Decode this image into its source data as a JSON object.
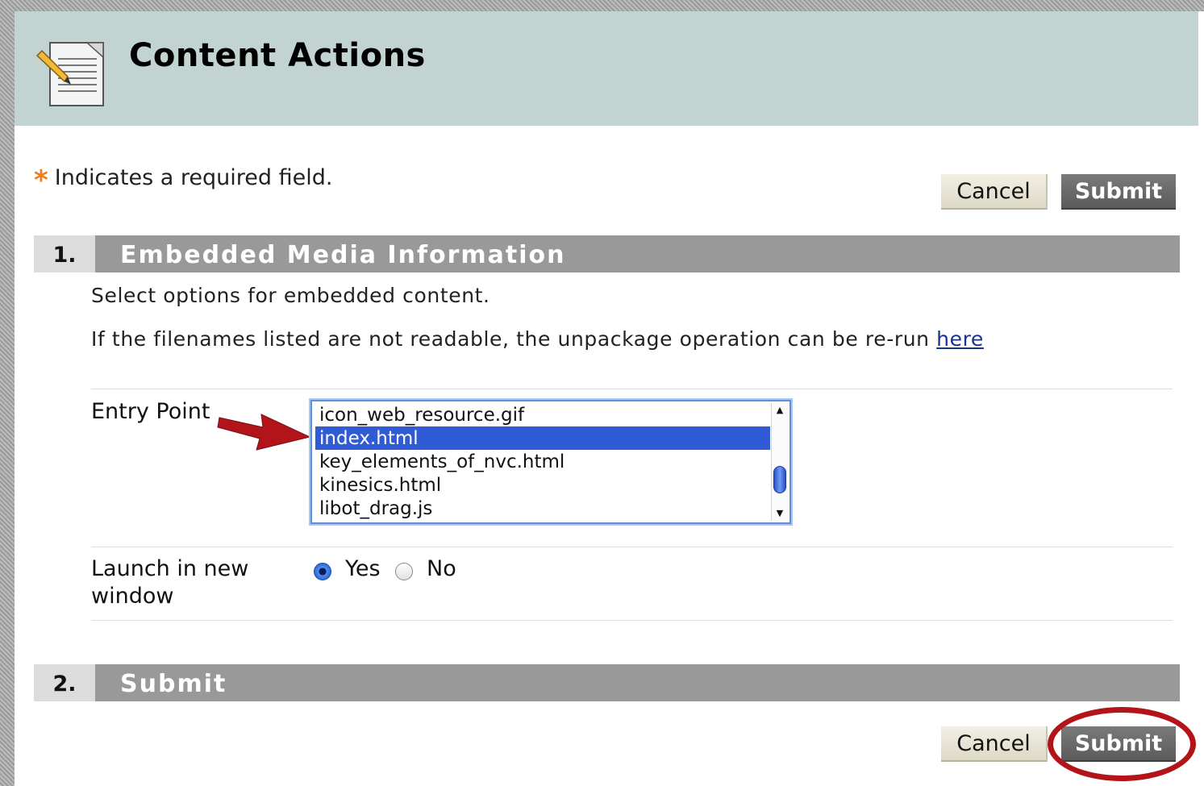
{
  "header": {
    "title": "Content Actions",
    "icon": "document-pencil-icon"
  },
  "required_note": {
    "marker": "*",
    "text": "Indicates a required field."
  },
  "buttons": {
    "cancel": "Cancel",
    "submit": "Submit"
  },
  "section1": {
    "number": "1.",
    "title": "Embedded Media Information",
    "description": "Select options for embedded content.",
    "rerun_text": "If the filenames listed are not readable, the unpackage operation can be re-run",
    "rerun_link": "here"
  },
  "entry_point": {
    "label": "Entry Point",
    "options": [
      "icon_web_resource.gif",
      "index.html",
      "key_elements_of_nvc.html",
      "kinesics.html",
      "libot_drag.js"
    ],
    "selected": "index.html"
  },
  "launch_new_window": {
    "label": "Launch in new window",
    "options": [
      "Yes",
      "No"
    ],
    "selected": "Yes"
  },
  "section2": {
    "number": "2.",
    "title": "Submit"
  },
  "colors": {
    "header_bg": "#c2d4d2",
    "section_bar": "#999999",
    "selection": "#2f5bd4",
    "required_star": "#ef7d1a",
    "annotation_red": "#b3141a"
  }
}
